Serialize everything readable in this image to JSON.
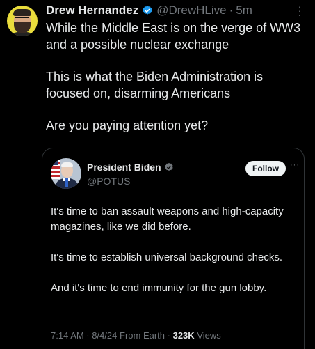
{
  "post": {
    "author_name": "Drew Hernandez",
    "author_handle": "@DrewHLive",
    "separator": "·",
    "time": "5m",
    "more_icon": "more-vertical-icon",
    "text": [
      "While the Middle East is on the verge of WW3 and a possible nuclear exchange",
      "This is what the Biden Administration is focused on, disarming Americans",
      "Are you paying attention yet?"
    ]
  },
  "quoted": {
    "author_name": "President Biden",
    "author_handle": "@POTUS",
    "follow_label": "Follow",
    "more_label": "···",
    "text": [
      "It's time to ban assault weapons and high-capacity magazines, like we did before.",
      "It's time to establish universal background checks.",
      "And it's time to end immunity for the gun lobby."
    ],
    "meta_time": "7:14 AM · 8/4/24 From Earth ·",
    "views_count": "323K",
    "views_label": "Views"
  },
  "colors": {
    "background": "#000000",
    "text_primary": "#e7e9ea",
    "text_secondary": "#71767b",
    "verified": "#1d9bf0",
    "border": "#2f3336"
  }
}
